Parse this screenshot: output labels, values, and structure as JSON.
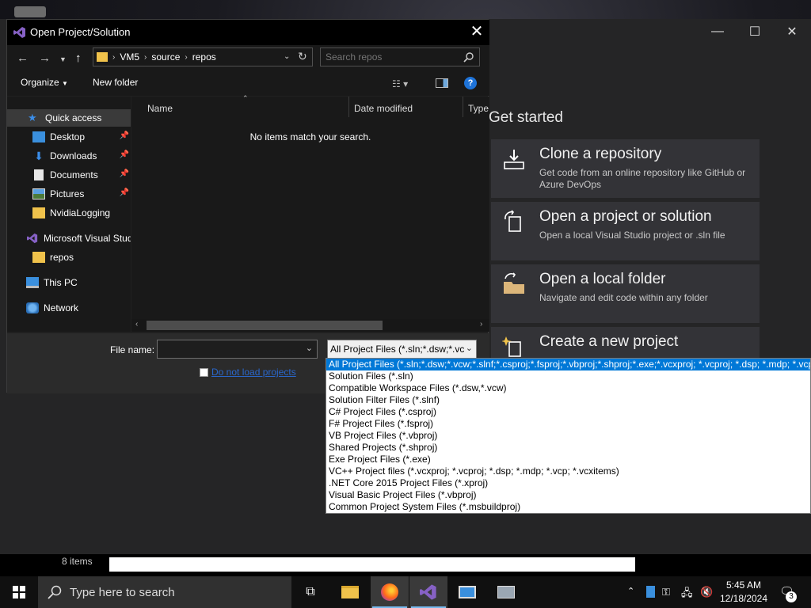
{
  "dialog": {
    "title": "Open Project/Solution",
    "close_glyph": "✕",
    "breadcrumb": [
      "VM5",
      "source",
      "repos"
    ],
    "search_placeholder": "Search repos",
    "toolbar": {
      "organize": "Organize",
      "new_folder": "New folder"
    },
    "nav": [
      {
        "label": "Quick access",
        "icon": "star-icon",
        "pinned": false
      },
      {
        "label": "Desktop",
        "icon": "desktop-icon",
        "pinned": true
      },
      {
        "label": "Downloads",
        "icon": "downloads-icon",
        "pinned": true
      },
      {
        "label": "Documents",
        "icon": "documents-icon",
        "pinned": true
      },
      {
        "label": "Pictures",
        "icon": "pictures-icon",
        "pinned": true
      },
      {
        "label": "NvidiaLogging",
        "icon": "folder-icon",
        "pinned": false
      },
      {
        "label": "Microsoft Visual Stud",
        "icon": "visual-studio-icon",
        "pinned": false
      },
      {
        "label": "repos",
        "icon": "folder-icon",
        "pinned": false
      },
      {
        "label": "This PC",
        "icon": "computer-icon",
        "pinned": false
      },
      {
        "label": "Network",
        "icon": "network-icon",
        "pinned": false
      }
    ],
    "columns": {
      "name": "Name",
      "date": "Date modified",
      "type": "Type"
    },
    "empty_message": "No items match your search.",
    "file_name_label": "File name:",
    "file_name_value": "",
    "file_type_selected": "All Project Files (*.sln;*.dsw;*.vc",
    "do_not_load_label": "Do not load projects"
  },
  "dropdown": {
    "options": [
      "All Project Files (*.sln;*.dsw;*.vcw;*.slnf;*.csproj;*.fsproj;*.vbproj;*.shproj;*.exe;*.vcxproj; *.vcproj; *.dsp; *.mdp; *.vcp;",
      "Solution Files (*.sln)",
      "Compatible Workspace Files (*.dsw,*.vcw)",
      "Solution Filter Files (*.slnf)",
      "C# Project Files (*.csproj)",
      "F# Project Files (*.fsproj)",
      "VB Project Files (*.vbproj)",
      "Shared Projects (*.shproj)",
      "Exe Project Files (*.exe)",
      "VC++ Project files (*.vcxproj; *.vcproj; *.dsp; *.mdp; *.vcp; *.vcxitems)",
      ".NET Core 2015 Project Files (*.xproj)",
      "Visual Basic Project Files (*.vbproj)",
      "Common Project System Files (*.msbuildproj)"
    ],
    "selected_index": 0
  },
  "vs": {
    "get_started": "Get started",
    "cards": [
      {
        "title": "Clone a repository",
        "desc": "Get code from an online repository like GitHub or Azure DevOps",
        "icon": "clone-icon"
      },
      {
        "title": "Open a project or solution",
        "desc": "Open a local Visual Studio project or .sln file",
        "icon": "open-project-icon"
      },
      {
        "title": "Open a local folder",
        "desc": "Navigate and edit code within any folder",
        "icon": "open-folder-icon"
      },
      {
        "title": "Create a new project",
        "desc": "",
        "icon": "new-project-icon"
      }
    ]
  },
  "explorer_status": {
    "items": "8 items"
  },
  "taskbar": {
    "search_placeholder": "Type here to search",
    "time": "5:45 AM",
    "date": "12/18/2024",
    "notification_count": "3"
  },
  "colors": {
    "accent": "#0078d7",
    "vs_purple": "#8661c5",
    "folder": "#f0c24b"
  }
}
